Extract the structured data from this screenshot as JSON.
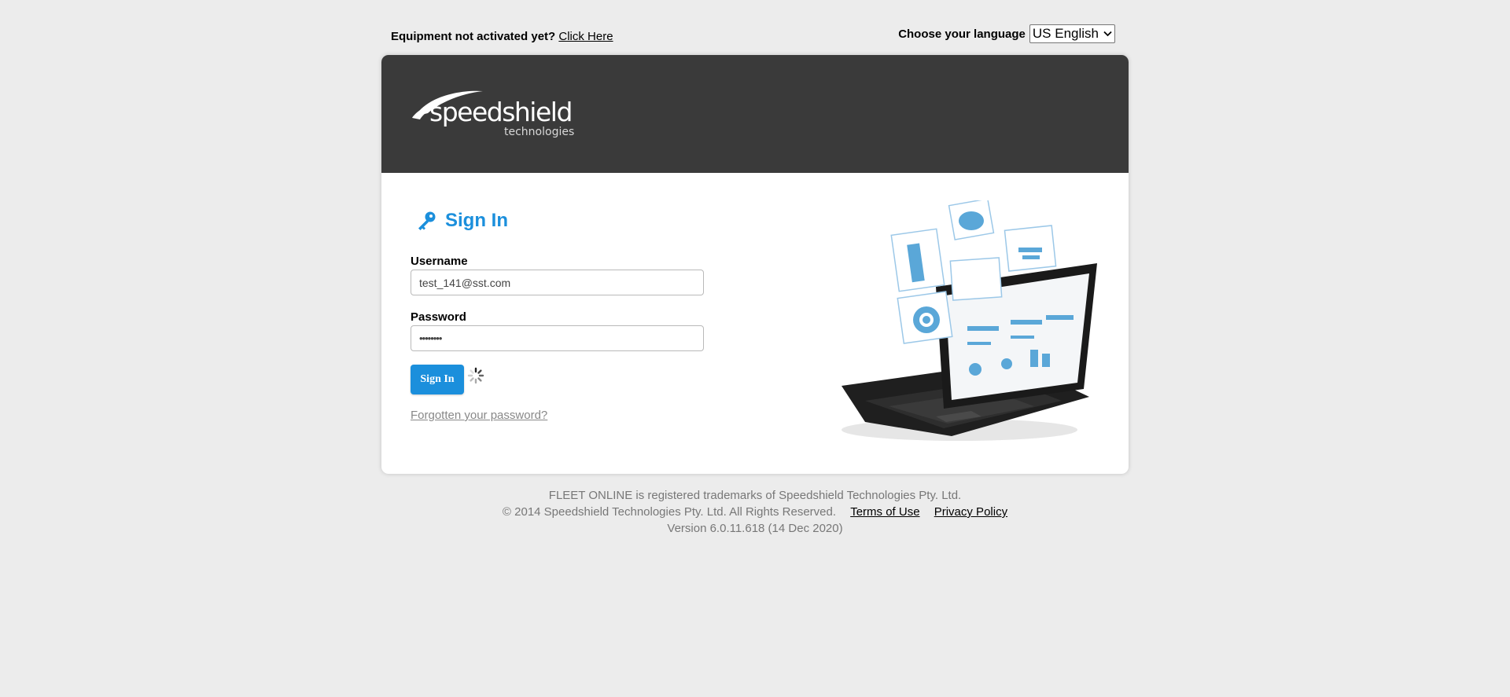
{
  "topbar": {
    "activate_text": "Equipment not activated yet?",
    "activate_link": "Click Here",
    "language_label": "Choose your language",
    "language_value": "US English"
  },
  "brand": {
    "logo_main": "speedshield",
    "logo_sub": "technologies",
    "header_color": "#3a3a3a",
    "accent": "#1b8fdc"
  },
  "signin": {
    "title": "Sign In",
    "username_label": "Username",
    "username_value": "test_141@sst.com",
    "password_label": "Password",
    "password_value": "••••••••",
    "submit_label": "Sign In",
    "forgot_label": "Forgotten your password?"
  },
  "footer": {
    "trademark": "FLEET ONLINE is registered trademarks of Speedshield Technologies Pty. Ltd.",
    "copyright": "© 2014 Speedshield Technologies Pty. Ltd. All Rights Reserved.",
    "terms": "Terms of Use",
    "privacy": "Privacy Policy",
    "version": "Version 6.0.11.618 (14 Dec 2020)"
  }
}
